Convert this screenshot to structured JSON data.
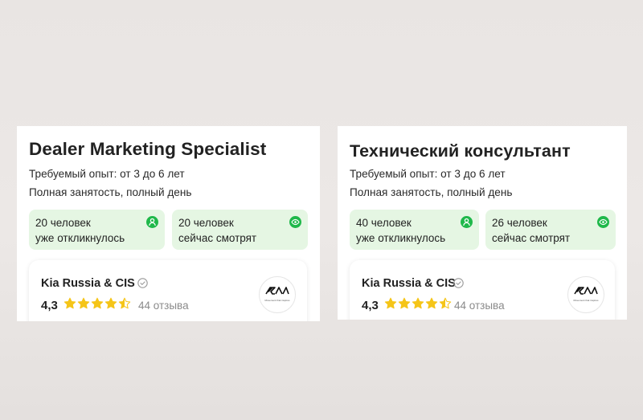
{
  "cards": [
    {
      "title": "Dealer Marketing Specialist",
      "experience": "Требуемый опыт: от 3 до 6 лет",
      "employment": "Полная занятость, полный день",
      "stats": [
        {
          "count": "20 человек",
          "label": "уже откликнулось",
          "icon": "person-icon"
        },
        {
          "count": "20 человек",
          "label": "сейчас смотрят",
          "icon": "eye-icon"
        }
      ],
      "company": {
        "name": "Kia Russia & CIS",
        "rating": "4,3",
        "stars_filled": 4.5,
        "reviews": "44 отзыва",
        "logo_tagline": "Movement that inspires"
      }
    },
    {
      "title": "Технический консультант",
      "experience": "Требуемый опыт: от 3 до 6 лет",
      "employment": "Полная занятость, полный день",
      "stats": [
        {
          "count": "40 человек",
          "label": "уже откликнулось",
          "icon": "person-icon"
        },
        {
          "count": "26 человек",
          "label": "сейчас смотрят",
          "icon": "eye-icon"
        }
      ],
      "company": {
        "name": "Kia Russia & CIS",
        "rating": "4,3",
        "stars_filled": 4.5,
        "reviews": "44 отзыва",
        "logo_tagline": "Movement that inspires"
      }
    }
  ],
  "colors": {
    "stat_background": "#e5f6e3",
    "stat_icon": "#1fb84a",
    "star": "#f5c518",
    "muted_text": "#8a8a8a"
  }
}
